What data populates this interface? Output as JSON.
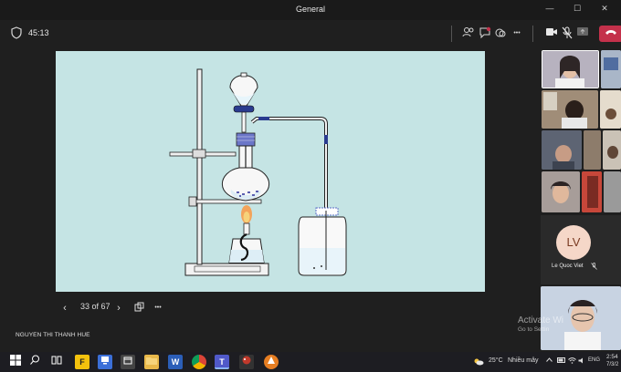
{
  "window": {
    "title": "General",
    "minimize_glyph": "—",
    "maximize_glyph": "☐",
    "close_glyph": "✕"
  },
  "meeting": {
    "timer": "45:13",
    "shield_icon": "shield-icon",
    "toolbar_icons": [
      "people-icon",
      "chat-icon",
      "reactions-icon",
      "more-icon",
      "camera-icon",
      "mic-off-icon",
      "share-icon",
      "hangup-icon"
    ],
    "more_glyph": "•••"
  },
  "slide": {
    "counter": "33 of 67",
    "prev_glyph": "‹",
    "next_glyph": "›",
    "more_glyph": "•••"
  },
  "presenter": {
    "name": "NGUYEN THI THANH HUE"
  },
  "participants": {
    "avatar_initials": "LV",
    "avatar_name": "Le Quoc Viet",
    "avatar_color": "#f5d7c8"
  },
  "watermark": {
    "line1": "Activate Wi",
    "line2": "Go to Settin"
  },
  "taskbar": {
    "weather": "25°C",
    "weather_text": "Nhiều mây",
    "language": "ENG",
    "time": "2:54",
    "date": "7/3/2"
  },
  "colors": {
    "slide_bg": "#c5e4e4",
    "hangup": "#c4314b"
  }
}
